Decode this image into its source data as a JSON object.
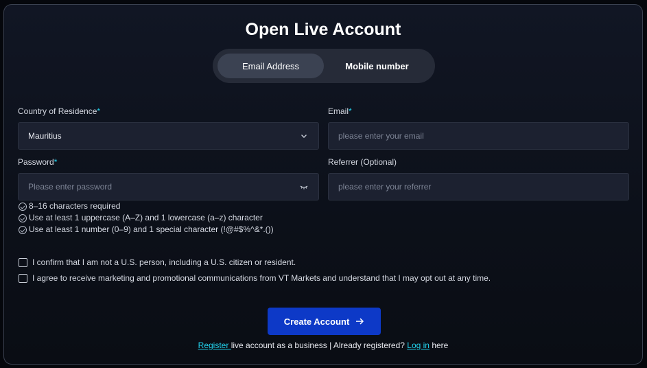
{
  "title": "Open Live Account",
  "tabs": [
    {
      "label": "Email Address",
      "active": true
    },
    {
      "label": "Mobile number",
      "active": false
    }
  ],
  "form": {
    "country": {
      "label": "Country of Residence",
      "required_mark": "*",
      "value": "Mauritius"
    },
    "email": {
      "label": "Email",
      "required_mark": "*",
      "placeholder": "please enter your email"
    },
    "password": {
      "label": "Password",
      "required_mark": "*",
      "placeholder": "Please enter password"
    },
    "referrer": {
      "label": "Referrer (Optional)",
      "placeholder": "please enter your referrer"
    }
  },
  "password_hints": [
    "8–16 characters required",
    "Use at least 1 uppercase (A–Z) and 1 lowercase (a–z) character",
    "Use at least 1 number (0–9) and 1 special character (!@#$%^&*.())"
  ],
  "consents": [
    "I confirm that I am not a U.S. person, including a U.S. citizen or resident.",
    "I agree to receive marketing and promotional communications from VT Markets and understand that I may opt out at any time."
  ],
  "cta_label": "Create Account",
  "footer": {
    "register_link": "Register ",
    "middle_text": "live account as a business | Already registered? ",
    "login_link": "Log in",
    "end_text": " here"
  },
  "colors": {
    "accent": "#22d3ee",
    "button": "#0d39c7"
  }
}
